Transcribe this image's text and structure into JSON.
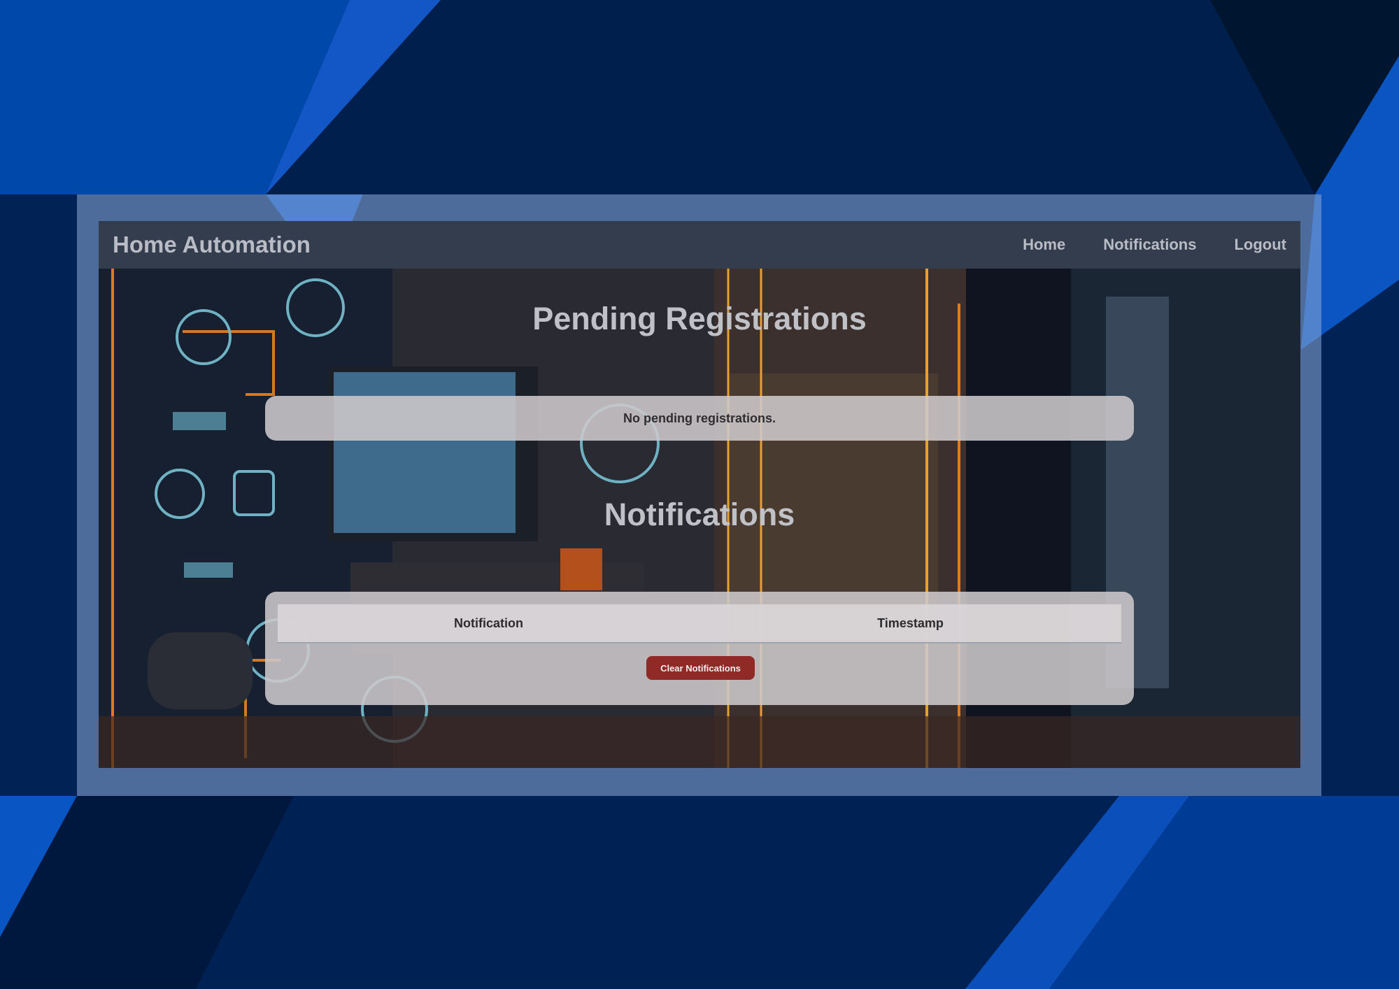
{
  "app": {
    "title": "Home Automation"
  },
  "nav": [
    {
      "label": "Home"
    },
    {
      "label": "Notifications"
    },
    {
      "label": "Logout"
    }
  ],
  "pending": {
    "title": "Pending Registrations",
    "empty_message": "No pending registrations."
  },
  "notifications": {
    "title": "Notifications",
    "columns": [
      "Notification",
      "Timestamp"
    ],
    "rows": [],
    "clear_label": "Clear Notifications"
  },
  "colors": {
    "page_background": "#02245a",
    "navbar": "#343d4e",
    "clear_button": "#8f2a27",
    "scene_accent": "#e07a1c"
  }
}
